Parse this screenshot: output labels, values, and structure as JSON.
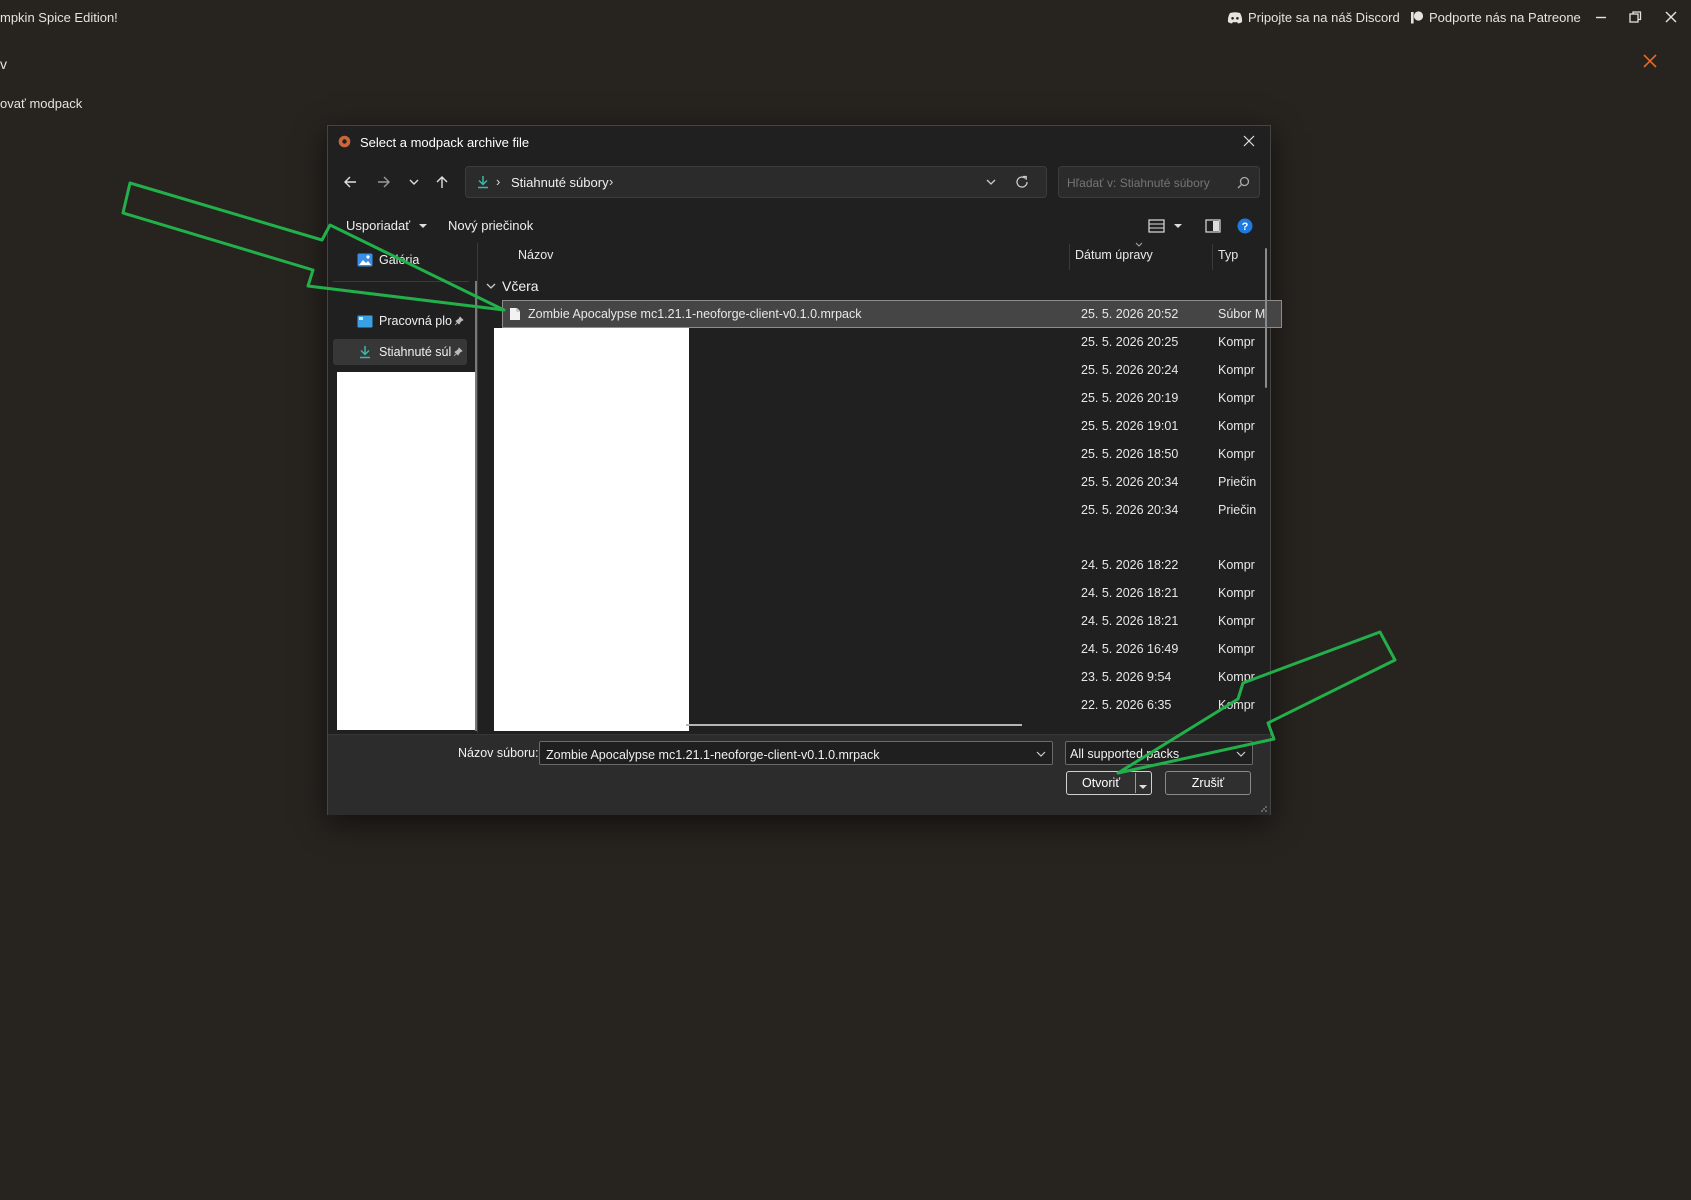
{
  "app": {
    "title": "mpkin Spice Edition!",
    "discord_label": "Pripojte sa na náš Discord",
    "patreon_label": "Podporte nás na Patreone",
    "side_chevron": "v",
    "side_action": "ovať modpack",
    "accent_color": "#e4692a"
  },
  "dialog": {
    "title": "Select a modpack archive file",
    "address": {
      "folder": "Stiahnuté súbory",
      "separator": "›"
    },
    "search_placeholder": "Hľadať v: Stiahnuté súbory",
    "commands": {
      "organize": "Usporiadať",
      "new_folder": "Nový priečinok"
    },
    "nav": {
      "gallery": "Galéria",
      "desktop": "Pracovná plo",
      "downloads": "Stiahnuté súl"
    },
    "columns": {
      "name": "Názov",
      "date": "Dátum úpravy",
      "type": "Typ"
    },
    "group": "Včera",
    "files": [
      {
        "name": "Zombie Apocalypse mc1.21.1-neoforge-client-v0.1.0.mrpack",
        "date": "25. 5. 2026 20:52",
        "type": "Súbor M",
        "selected": true
      },
      {
        "name": "",
        "date": "25. 5. 2026 20:25",
        "type": "Kompr"
      },
      {
        "name": "",
        "date": "25. 5. 2026 20:24",
        "type": "Kompr"
      },
      {
        "name": "",
        "date": "25. 5. 2026 20:19",
        "type": "Kompr"
      },
      {
        "name": "",
        "date": "25. 5. 2026 19:01",
        "type": "Kompr"
      },
      {
        "name": "",
        "date": "25. 5. 2026 18:50",
        "type": "Kompr"
      },
      {
        "name": "",
        "date": "25. 5. 2026 20:34",
        "type": "Priečin"
      },
      {
        "name": "",
        "date": "25. 5. 2026 20:34",
        "type": "Priečin"
      },
      {
        "name": "",
        "date": "24. 5. 2026 18:22",
        "type": "Kompr"
      },
      {
        "name": "",
        "date": "24. 5. 2026 18:21",
        "type": "Kompr"
      },
      {
        "name": "",
        "date": "24. 5. 2026 18:21",
        "type": "Kompr"
      },
      {
        "name": "",
        "date": "24. 5. 2026 16:49",
        "type": "Kompr"
      },
      {
        "name": "",
        "date": "23. 5. 2026 9:54",
        "type": "Kompr"
      },
      {
        "name": "",
        "date": "22. 5. 2026 6:35",
        "type": "Kompr"
      }
    ],
    "filename_label": "Názov súboru:",
    "filename_value": "Zombie Apocalypse mc1.21.1-neoforge-client-v0.1.0.mrpack",
    "filetype_value": "All supported packs",
    "open_label": "Otvoriť",
    "cancel_label": "Zrušiť",
    "annotation_color": "#22b04a"
  }
}
